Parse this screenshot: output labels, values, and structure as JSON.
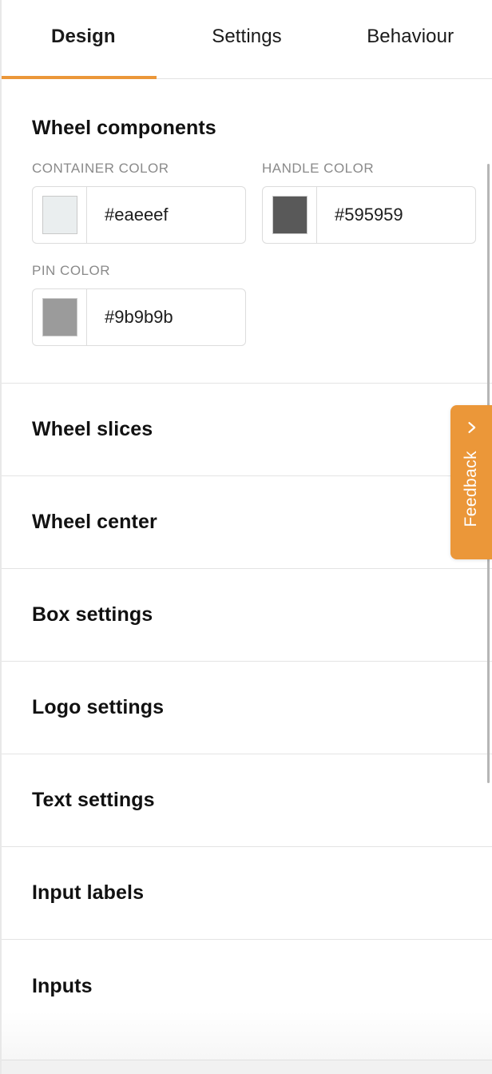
{
  "tabs": {
    "items": [
      {
        "label": "Design",
        "active": true
      },
      {
        "label": "Settings",
        "active": false
      },
      {
        "label": "Behaviour",
        "active": false
      }
    ],
    "active_indicator_color": "#eb9739"
  },
  "section": {
    "title": "Wheel components",
    "fields": [
      {
        "label": "CONTAINER COLOR",
        "value": "#eaeeef",
        "swatch": "#eaeeef"
      },
      {
        "label": "HANDLE COLOR",
        "value": "#595959",
        "swatch": "#595959"
      },
      {
        "label": "PIN COLOR",
        "value": "#9b9b9b",
        "swatch": "#9b9b9b"
      }
    ]
  },
  "accordion": {
    "rows": [
      {
        "label": "Wheel slices"
      },
      {
        "label": "Wheel center"
      },
      {
        "label": "Box settings"
      },
      {
        "label": "Logo settings"
      },
      {
        "label": "Text settings"
      },
      {
        "label": "Input labels"
      },
      {
        "label": "Inputs"
      }
    ]
  },
  "feedback": {
    "label": "Feedback",
    "icon": "chevron-right-icon",
    "color": "#eb9739"
  }
}
